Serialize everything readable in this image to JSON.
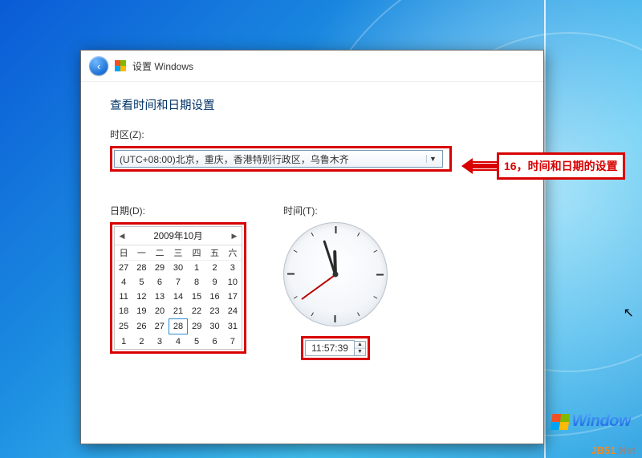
{
  "window": {
    "title": "设置 Windows"
  },
  "page": {
    "heading": "查看时间和日期设置"
  },
  "timezone": {
    "label": "时区(Z):",
    "selected": "(UTC+08:00)北京，重庆，香港特别行政区，乌鲁木齐"
  },
  "date": {
    "label": "日期(D):",
    "month_title": "2009年10月",
    "weekdays": [
      "日",
      "一",
      "二",
      "三",
      "四",
      "五",
      "六"
    ],
    "leading_dim": [
      27,
      28,
      29,
      30
    ],
    "days": [
      1,
      2,
      3,
      4,
      5,
      6,
      7,
      8,
      9,
      10,
      11,
      12,
      13,
      14,
      15,
      16,
      17,
      18,
      19,
      20,
      21,
      22,
      23,
      24,
      25,
      26,
      27,
      28,
      29,
      30,
      31
    ],
    "trailing_dim": [
      1,
      2,
      3,
      4,
      5,
      6,
      7
    ],
    "selected_day": 28
  },
  "time": {
    "label": "时间(T):",
    "value": "11:57:39",
    "hour": 11,
    "minute": 57,
    "second": 39
  },
  "annotation": {
    "text": "16，时间和日期的设置"
  },
  "brand": {
    "text": "Window"
  },
  "site": {
    "a": "JB51",
    "b": ".Net"
  }
}
